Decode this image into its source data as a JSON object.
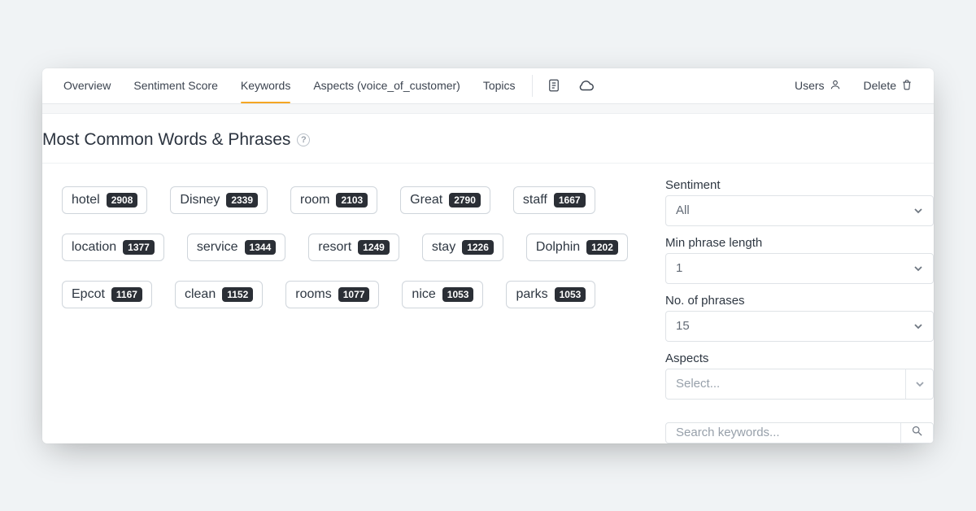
{
  "nav": {
    "tabs": [
      {
        "label": "Overview"
      },
      {
        "label": "Sentiment Score"
      },
      {
        "label": "Keywords",
        "active": true
      },
      {
        "label": "Aspects (voice_of_customer)"
      },
      {
        "label": "Topics"
      }
    ],
    "users_label": "Users",
    "delete_label": "Delete"
  },
  "heading": {
    "title": "Most Common Words & Phrases"
  },
  "keywords": [
    {
      "word": "hotel",
      "count": "2908"
    },
    {
      "word": "Disney",
      "count": "2339"
    },
    {
      "word": "room",
      "count": "2103"
    },
    {
      "word": "Great",
      "count": "2790"
    },
    {
      "word": "staff",
      "count": "1667"
    },
    {
      "word": "location",
      "count": "1377"
    },
    {
      "word": "service",
      "count": "1344"
    },
    {
      "word": "resort",
      "count": "1249"
    },
    {
      "word": "stay",
      "count": "1226"
    },
    {
      "word": "Dolphin",
      "count": "1202"
    },
    {
      "word": "Epcot",
      "count": "1167"
    },
    {
      "word": "clean",
      "count": "1152"
    },
    {
      "word": "rooms",
      "count": "1077"
    },
    {
      "word": "nice",
      "count": "1053"
    },
    {
      "word": "parks",
      "count": "1053"
    }
  ],
  "filters": {
    "sentiment": {
      "label": "Sentiment",
      "value": "All"
    },
    "min_phrase_length": {
      "label": "Min phrase length",
      "value": "1"
    },
    "num_phrases": {
      "label": "No. of phrases",
      "value": "15"
    },
    "aspects": {
      "label": "Aspects",
      "placeholder": "Select..."
    },
    "search": {
      "placeholder": "Search keywords..."
    }
  }
}
